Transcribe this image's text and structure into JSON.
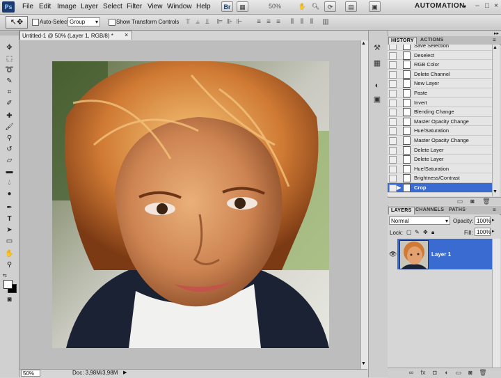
{
  "app": {
    "logo": "Ps",
    "menus": [
      "File",
      "Edit",
      "Image",
      "Layer",
      "Select",
      "Filter",
      "View",
      "Window",
      "Help"
    ],
    "app_bar": {
      "bridge_btn": "Br",
      "zoom": "50%",
      "workspace": "AUTOMATION"
    },
    "window_controls": {
      "minimize": "–",
      "maximize": "□",
      "close": "×"
    }
  },
  "options_bar": {
    "auto_select_label": "Auto-Select:",
    "auto_select_value": "Group",
    "show_transform_label": "Show Transform Controls"
  },
  "document": {
    "tab_title": "Untitled-1 @ 50% (Layer 1, RGB/8) *",
    "tab_close": "×",
    "status_zoom": "50%",
    "doc_size": "Doc: 3,98M/3,98M"
  },
  "history_panel": {
    "tabs": [
      "HISTORY",
      "ACTIONS"
    ],
    "items": [
      {
        "label": "Save Selection"
      },
      {
        "label": "Deselect"
      },
      {
        "label": "RGB Color"
      },
      {
        "label": "Delete Channel"
      },
      {
        "label": "New Layer"
      },
      {
        "label": "Paste"
      },
      {
        "label": "Invert"
      },
      {
        "label": "Blending Change"
      },
      {
        "label": "Master Opacity Change"
      },
      {
        "label": "Hue/Saturation"
      },
      {
        "label": "Master Opacity Change"
      },
      {
        "label": "Delete Layer"
      },
      {
        "label": "Delete Layer"
      },
      {
        "label": "Hue/Saturation"
      },
      {
        "label": "Brightness/Contrast"
      },
      {
        "label": "Crop",
        "selected": true
      }
    ]
  },
  "layers_panel": {
    "tabs": [
      "LAYERS",
      "CHANNELS",
      "PATHS"
    ],
    "blend_mode": "Normal",
    "opacity_label": "Opacity:",
    "opacity_value": "100%",
    "lock_label": "Lock:",
    "fill_label": "Fill:",
    "fill_value": "100%",
    "layers": [
      {
        "name": "Layer 1",
        "visible": true,
        "selected": true
      }
    ]
  },
  "colors": {
    "selection": "#3a6bd0",
    "chrome": "#d4d4d4"
  }
}
